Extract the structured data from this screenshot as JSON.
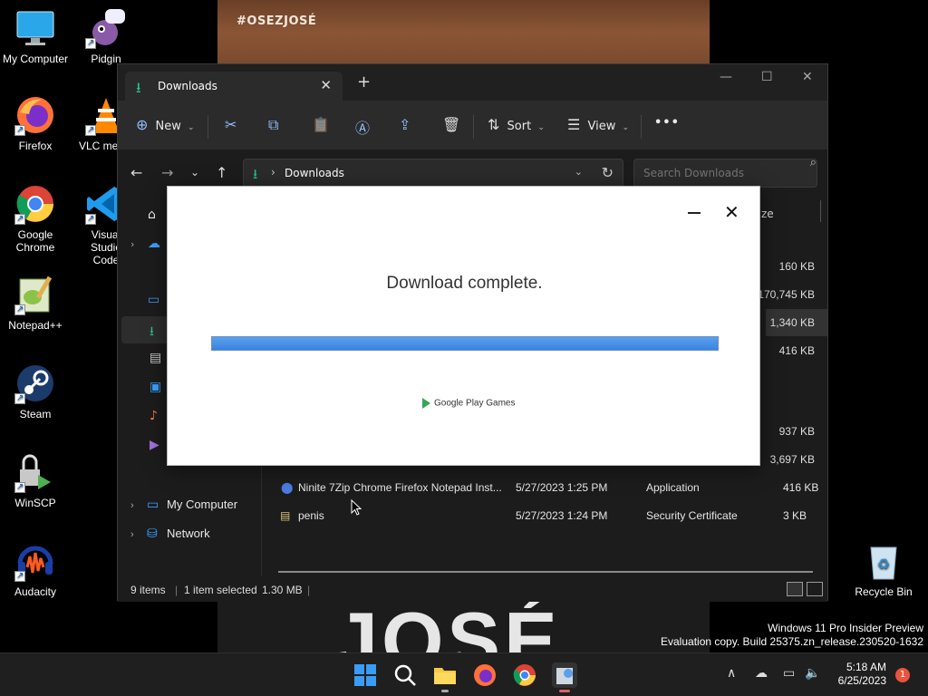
{
  "wallpaper": {
    "tag": "#OSEZJOSÉ",
    "big_text": "JOSÉ"
  },
  "desktop_icons": [
    {
      "label": "My Computer"
    },
    {
      "label": "Pidgin"
    },
    {
      "label": "Firefox"
    },
    {
      "label": "VLC media player"
    },
    {
      "label": "Google Chrome"
    },
    {
      "label": "Visual Studio Code"
    },
    {
      "label": "Notepad++"
    },
    {
      "label": "Steam"
    },
    {
      "label": "WinSCP"
    },
    {
      "label": "Audacity"
    },
    {
      "label": "Recycle Bin"
    }
  ],
  "explorer": {
    "tab_title": "Downloads",
    "toolbar": {
      "new_label": "New",
      "sort_label": "Sort",
      "view_label": "View"
    },
    "address": {
      "path": "Downloads"
    },
    "search": {
      "placeholder": "Search Downloads"
    },
    "nav": {
      "my_computer": "My Computer",
      "network": "Network"
    },
    "columns": {
      "size": "ze"
    },
    "sizes": [
      "160 KB",
      "170,745 KB",
      "1,340 KB",
      "416 KB",
      "937 KB",
      "3,697 KB"
    ],
    "rows": [
      {
        "name": "Ninite 7Zip Chrome Firefox Notepad Inst...",
        "date": "5/27/2023 1:25 PM",
        "type": "Application",
        "size": "416 KB"
      },
      {
        "name": "penis",
        "date": "5/27/2023 1:24 PM",
        "type": "Security Certificate",
        "size": "3 KB"
      }
    ],
    "status": {
      "items": "9 items",
      "selected": "1 item selected",
      "size": "1.30 MB"
    }
  },
  "dialog": {
    "message": "Download complete.",
    "progress": 1.0,
    "brand": "Google Play Games"
  },
  "watermark": {
    "line1": "Windows 11 Pro Insider Preview",
    "line2": "Evaluation copy. Build 25375.zn_release.230520-1632"
  },
  "clock": {
    "time": "5:18 AM",
    "date": "6/25/2023"
  },
  "notifications": {
    "count": "1"
  },
  "colors": {
    "accent": "#2bc08a",
    "progress": "#3b82e0",
    "badge": "#e8543e"
  }
}
